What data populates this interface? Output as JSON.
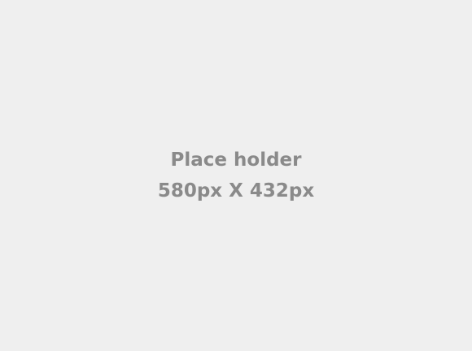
{
  "placeholder": {
    "title": "Place holder",
    "dimensions": "580px X 432px",
    "background_color": "#efefef",
    "text_color": "#8a8a8a"
  }
}
